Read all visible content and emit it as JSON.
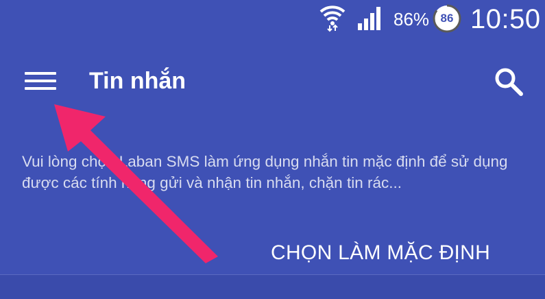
{
  "status_bar": {
    "battery_percent": "86%",
    "battery_badge": "86",
    "time": "10:50",
    "icons": [
      "wifi-icon",
      "signal-icon",
      "battery-icon"
    ]
  },
  "toolbar": {
    "title": "Tin nhắn",
    "menu_icon": "menu-icon",
    "search_icon": "search-icon"
  },
  "content": {
    "message": "Vui lòng chọn Laban SMS làm ứng dụng nhắn tin mặc định để sử dụng được các tính năng gửi và nhận tin nhắn, chặn tin rác...",
    "default_button_label": "CHỌN LÀM MẶC ĐỊNH"
  },
  "annotation": {
    "arrow_color": "#f0266b",
    "points_to": "menu-icon"
  },
  "colors": {
    "primary": "#3f51b5",
    "text": "#ffffff"
  }
}
